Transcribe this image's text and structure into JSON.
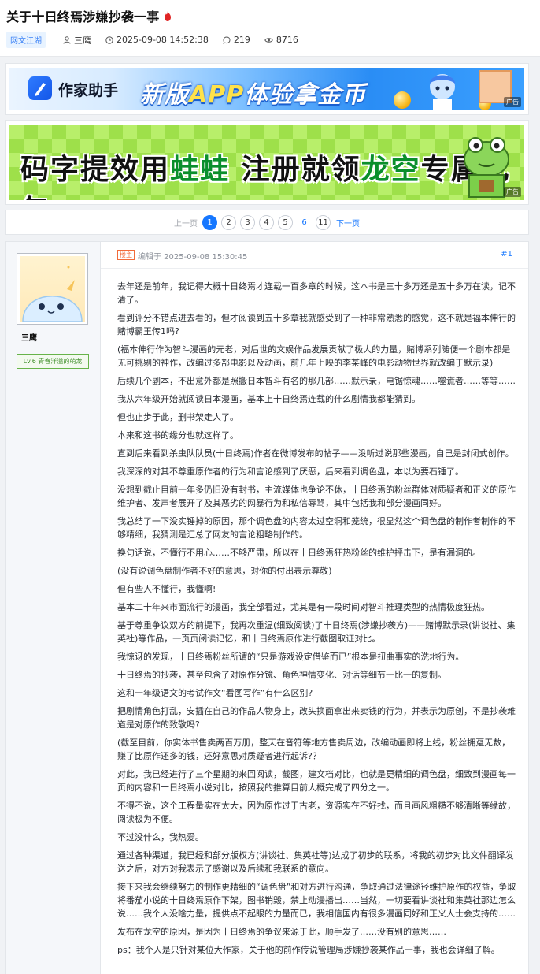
{
  "thread": {
    "title": "关于十日终焉涉嫌抄袭一事",
    "category": "网文江湖",
    "author": "三鹰",
    "posted_at": "2025-09-08 14:52:38",
    "comments": "219",
    "views": "8716"
  },
  "ads": {
    "ad1": {
      "brand": "作家助手",
      "slogan_a": "新版",
      "slogan_b": "APP",
      "slogan_c": "体验拿金币",
      "tag": "广告"
    },
    "ad2": {
      "slogan_a": "码字提效用",
      "slogan_b": "蛙蛙",
      "slogan_c": "注册就领",
      "slogan_d": "龙空",
      "slogan_e": "专属礼包",
      "tag": "广告"
    }
  },
  "pager": {
    "prev": "上一页",
    "pages": [
      "1",
      "2",
      "3",
      "4",
      "5",
      "6",
      "11"
    ],
    "active": "1",
    "next": "下一页"
  },
  "post": {
    "author": "三鹰",
    "level": "Lv.6 青春洋溢的萌龙",
    "lz_tag": "楼主",
    "edited": "编辑于 2025-09-08 15:30:45",
    "floor": "#1",
    "paragraphs": [
      "去年还是前年，我记得大概十日终焉才连载一百多章的时候，这本书是三十多万还是五十多万在读，记不清了。",
      "看到评分不错点进去看的，但才阅读到五十多章我就感受到了一种非常熟悉的感觉，这不就是福本伸行的赌博霸王传1吗?",
      "(福本伸行作为智斗漫画的元老，对后世的文娱作品发展贡献了极大的力量，赌博系列随便一个剧本都是无可挑剔的神作，改编过多部电影以及动画，前几年上映的李某峰的电影动物世界就改编于默示录)",
      "后续几个副本，不出意外都是照搬日本智斗有名的那几部……默示录，电锯惊魂……噬谎者……等等……",
      "我从六年级开始就阅读日本漫画，基本上十日终焉连载的什么剧情我都能猜到。",
      "但也止步于此，删书架走人了。",
      "本来和这书的缘分也就这样了。",
      "直到后来看到杀虫队队员(十日终焉)作者在微博发布的帖子——没听过说那些漫画，自己是封闭式创作。",
      "我深深的对其不尊重原作者的行为和言论感到了厌恶，后来看到调色盘，本以为要石锤了。",
      "没想到截止目前一年多仍旧没有封书，主流媒体也争论不休，十日终焉的粉丝群体对质疑者和正义的原作维护者、发声者展开了及其恶劣的网暴行为和私信辱骂，其中包括我和部分漫画同好。",
      "我总结了一下没实锤掉的原因，那个调色盘的内容太过空洞和笼统，很显然这个调色盘的制作者制作的不够精细，我猜测是汇总了网友的言论粗略制作的。",
      "换句话说，不懂行不用心……不够严肃，所以在十日终焉狂热粉丝的维护抨击下，是有漏洞的。",
      "(没有说调色盘制作者不好的意思，对你的付出表示尊敬)",
      "但有些人不懂行，我懂啊!",
      "基本二十年来市面流行的漫画，我全部看过，尤其是有一段时间对智斗推理类型的热情极度狂热。",
      "基于尊重争议双方的前提下，我再次重温(细致阅读)了十日终焉(涉嫌抄袭方)——赌博默示录(讲谈社、集英社)等作品，一页页阅读记忆，和十日终焉原作进行截图取证对比。",
      "我惊讶的发现，十日终焉粉丝所谓的“只是游戏设定借鉴而已”根本是扭曲事实的洗地行为。",
      "十日终焉的抄袭，甚至包含了对原作分镜、角色神情变化、对话等细节一比一的复制。",
      "这和一年级语文的考试作文“看图写作”有什么区别?",
      "把剧情角色打乱，安插在自己的作品人物身上，改头换面拿出来卖钱的行为，并表示为原创，不是抄袭难道是对原作的致敬吗?",
      "(截至目前，你实体书售卖两百万册，整天在音符等地方售卖周边，改编动画即将上线，粉丝拥趸无数，赚了比原作还多的钱，还好意思对质疑者进行起诉?？",
      "对此，我已经进行了三个星期的来回阅读，截图，建文档对比，也就是更精细的调色盘，细致到漫画每一页的内容和十日终焉小说对比，按照我的推算目前大概完成了四分之一。",
      "不得不说，这个工程量实在太大，因为原作过于古老，资源实在不好找，而且画风粗糙不够清晰等缘故，阅读极为不便。",
      "不过没什么，我热爱。",
      "通过各种渠道，我已经和部分版权方(讲谈社、集英社等)达成了初步的联系，将我的初步对比文件翻译发送之后，对方对我表示了感谢以及后续和我联系的意向。",
      "接下来我会继续努力的制作更精细的“调色盘”和对方进行沟通，争取通过法律途径维护原作的权益，争取将番茄小说的十日终焉原作下架，图书销毁，禁止动漫播出……当然，一切要看讲谈社和集英社那边怎么说……我个人没啥力量，提供点不起眼的力量而已，我相信国内有很多漫画同好和正义人士会支持的……",
      "发布在龙空的原因，是因为十日终焉的争议来源于此，顺手发了……没有别的意思……",
      "ps：我个人是只针对某位大作家，关于他的前作传说管理局涉嫌抄袭某作品一事，我也会详细了解。"
    ]
  }
}
